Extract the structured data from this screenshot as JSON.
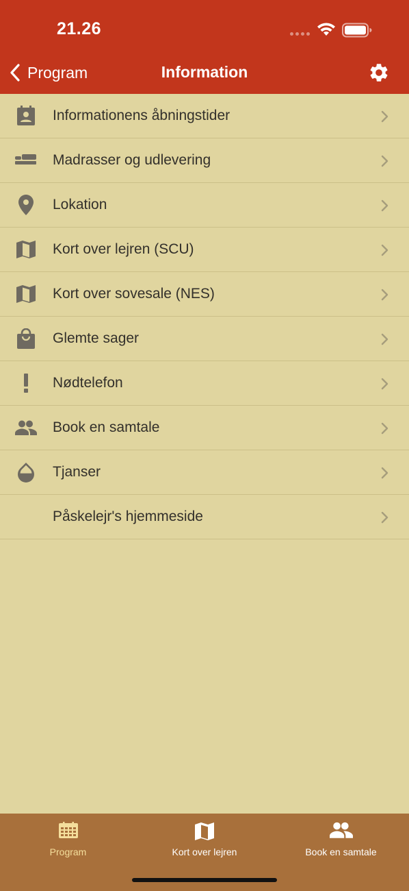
{
  "status_bar": {
    "time": "21.26"
  },
  "nav": {
    "back_label": "Program",
    "title": "Information",
    "settings_icon": "gear-icon"
  },
  "menu": {
    "items": [
      {
        "label": "Informationens åbningstider",
        "icon": "contact-calendar-icon"
      },
      {
        "label": "Madrasser og udlevering",
        "icon": "bed-icon"
      },
      {
        "label": "Lokation",
        "icon": "location-pin-icon"
      },
      {
        "label": "Kort over lejren (SCU)",
        "icon": "map-icon"
      },
      {
        "label": "Kort over sovesale (NES)",
        "icon": "map-icon"
      },
      {
        "label": "Glemte sager",
        "icon": "shopping-bag-icon"
      },
      {
        "label": "Nødtelefon",
        "icon": "exclamation-icon"
      },
      {
        "label": "Book en samtale",
        "icon": "people-icon"
      },
      {
        "label": "Tjanser",
        "icon": "drop-icon"
      },
      {
        "label": "Påskelejr's hjemmeside",
        "icon": ""
      }
    ]
  },
  "tabs": [
    {
      "label": "Program",
      "icon": "calendar-grid-icon",
      "active": true
    },
    {
      "label": "Kort over lejren",
      "icon": "map-icon",
      "active": false
    },
    {
      "label": "Book en samtale",
      "icon": "people-icon",
      "active": false
    }
  ],
  "colors": {
    "header": "#C2361C",
    "background": "#E0D59F",
    "tab_bar": "#A8703B",
    "active_tab": "#F4DE9C",
    "icon_gray": "#6f6a60"
  }
}
